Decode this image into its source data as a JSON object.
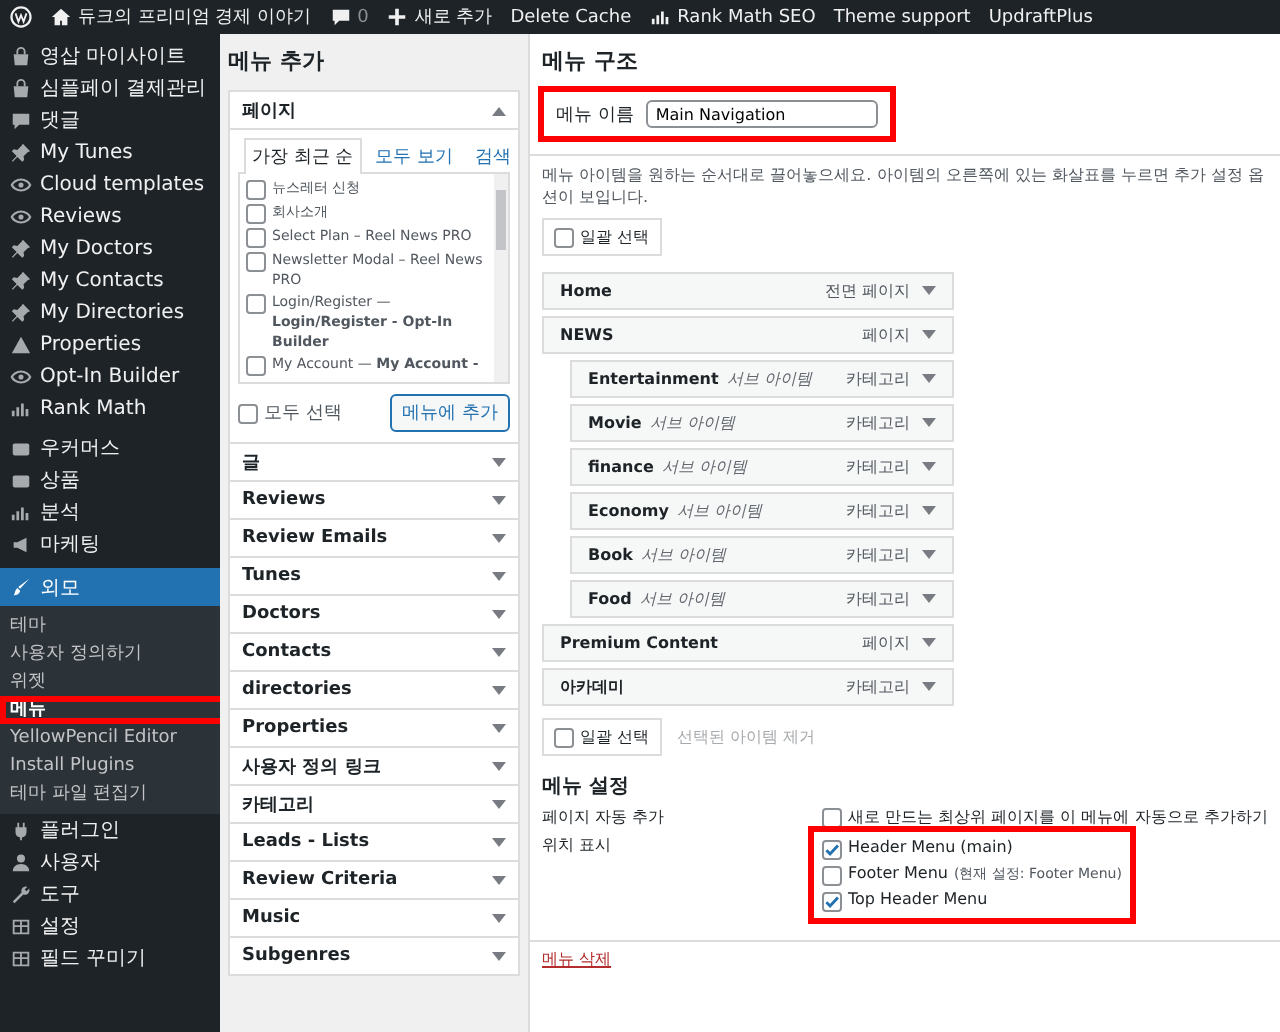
{
  "admin_bar": {
    "site_title": "듀크의 프리미엄 경제 이야기",
    "comments": "0",
    "new_label": "새로 추가",
    "links": [
      {
        "kind": "plain",
        "label": "Delete Cache"
      },
      {
        "kind": "chart",
        "label": "Rank Math SEO"
      },
      {
        "kind": "plain",
        "label": "Theme support"
      },
      {
        "kind": "plain",
        "label": "UpdraftPlus"
      }
    ]
  },
  "sidebar": {
    "groups": [
      {
        "items": [
          {
            "label": "영삽 마이사이트",
            "selected": false
          },
          {
            "label": "심플페이 결제관리",
            "selected": false
          },
          {
            "label": "댓글",
            "selected": false
          },
          {
            "label": "My Tunes",
            "selected": false
          },
          {
            "label": "Cloud templates",
            "selected": false
          },
          {
            "label": "Reviews",
            "selected": false
          },
          {
            "label": "My Doctors",
            "selected": false
          },
          {
            "label": "My Contacts",
            "selected": false
          },
          {
            "label": "My Directories",
            "selected": false
          },
          {
            "label": "Properties",
            "selected": false
          },
          {
            "label": "Opt-In Builder",
            "selected": false
          },
          {
            "label": "Rank Math",
            "selected": false
          }
        ]
      },
      {
        "items": [
          {
            "label": "우커머스",
            "selected": false
          },
          {
            "label": "상품",
            "selected": false
          },
          {
            "label": "분석",
            "selected": false
          },
          {
            "label": "마케팅",
            "selected": false
          }
        ]
      },
      {
        "items": [
          {
            "label": "외모",
            "selected": true,
            "children": [
              {
                "label": "테마",
                "selected": false,
                "highlighted": false
              },
              {
                "label": "사용자 정의하기",
                "selected": false,
                "highlighted": false
              },
              {
                "label": "위젯",
                "selected": false,
                "highlighted": false
              },
              {
                "label": "메뉴",
                "selected": true,
                "highlighted": true
              },
              {
                "label": "YellowPencil Editor",
                "selected": false,
                "highlighted": false
              },
              {
                "label": "Install Plugins",
                "selected": false,
                "highlighted": false
              },
              {
                "label": "테마 파일 편집기",
                "selected": false,
                "highlighted": false
              }
            ]
          },
          {
            "label": "플러그인",
            "selected": false
          },
          {
            "label": "사용자",
            "selected": false
          },
          {
            "label": "도구",
            "selected": false
          },
          {
            "label": "설정",
            "selected": false
          },
          {
            "label": "필드 꾸미기",
            "selected": false
          }
        ]
      }
    ]
  },
  "add_menu_items": {
    "title": "메뉴 추가",
    "sections": [
      {
        "title": "페이지",
        "expanded": true,
        "tabs": [
          {
            "label": "가장 최근 순",
            "selected": true
          },
          {
            "label": "모두 보기",
            "selected": false
          },
          {
            "label": "검색",
            "selected": false
          }
        ],
        "items": [
          {
            "label": "뉴스레터 신청",
            "checked": false
          },
          {
            "label": "회사소개",
            "checked": false
          },
          {
            "label": "Select Plan – Reel News PRO",
            "checked": false
          },
          {
            "label": "Newsletter Modal – Reel News PRO",
            "checked": false
          },
          {
            "label": "Login/Register — **Login/Register - Opt-In Builder**",
            "checked": false
          },
          {
            "label": "My Account — **My Account -**",
            "checked": false
          }
        ],
        "select_all": {
          "label": "모두 선택",
          "checked": false
        },
        "add_button": "메뉴에 추가"
      },
      {
        "title": "글",
        "expanded": false
      },
      {
        "title": "Reviews",
        "expanded": false
      },
      {
        "title": "Review Emails",
        "expanded": false
      },
      {
        "title": "Tunes",
        "expanded": false
      },
      {
        "title": "Doctors",
        "expanded": false
      },
      {
        "title": "Contacts",
        "expanded": false
      },
      {
        "title": "directories",
        "expanded": false
      },
      {
        "title": "Properties",
        "expanded": false
      },
      {
        "title": "사용자 정의 링크",
        "expanded": false
      },
      {
        "title": "카테고리",
        "expanded": false
      },
      {
        "title": "Leads - Lists",
        "expanded": false
      },
      {
        "title": "Review Criteria",
        "expanded": false
      },
      {
        "title": "Music",
        "expanded": false
      },
      {
        "title": "Subgenres",
        "expanded": false
      }
    ]
  },
  "menu_structure": {
    "title": "메뉴 구조",
    "name_label": "메뉴 이름",
    "name_value": "Main Navigation",
    "name_highlighted": true,
    "instructions": "메뉴 아이템을 원하는 순서대로 끌어놓으세요. 아이템의 오른쪽에 있는 화살표를 누르면 추가 설정 옵션이 보입니다.",
    "bulk_select_top": {
      "label": "일괄 선택",
      "checked": false
    },
    "items": [
      {
        "title": "Home",
        "type": "전면 페이지"
      },
      {
        "title": "NEWS",
        "type": "페이지",
        "children": [
          {
            "title": "Entertainment",
            "sub": "서브 아이템",
            "type": "카테고리"
          },
          {
            "title": "Movie",
            "sub": "서브 아이템",
            "type": "카테고리"
          },
          {
            "title": "finance",
            "sub": "서브 아이템",
            "type": "카테고리"
          },
          {
            "title": "Economy",
            "sub": "서브 아이템",
            "type": "카테고리"
          },
          {
            "title": "Book",
            "sub": "서브 아이템",
            "type": "카테고리"
          },
          {
            "title": "Food",
            "sub": "서브 아이템",
            "type": "카테고리"
          }
        ]
      },
      {
        "title": "Premium Content",
        "type": "페이지"
      },
      {
        "title": "아카데미",
        "type": "카테고리"
      }
    ],
    "bulk_select_bottom": {
      "label": "일괄 선택",
      "checked": false
    },
    "remove_selected": {
      "label": "선택된 아이템 제거",
      "disabled": true
    }
  },
  "menu_settings": {
    "title": "메뉴 설정",
    "auto_add_label": "페이지 자동 추가",
    "auto_add_option": {
      "label": "새로 만드는 최상위 페이지를 이 메뉴에 자동으로 추가하기",
      "checked": false
    },
    "locations_label": "위치 표시",
    "locations_highlighted": true,
    "locations": [
      {
        "label": "Header Menu (main)",
        "checked": true
      },
      {
        "label": "Footer Menu",
        "note": "(현재 설정: Footer Menu)",
        "checked": false
      },
      {
        "label": "Top Header Menu",
        "checked": true
      }
    ]
  },
  "delete_link": "메뉴 삭제"
}
